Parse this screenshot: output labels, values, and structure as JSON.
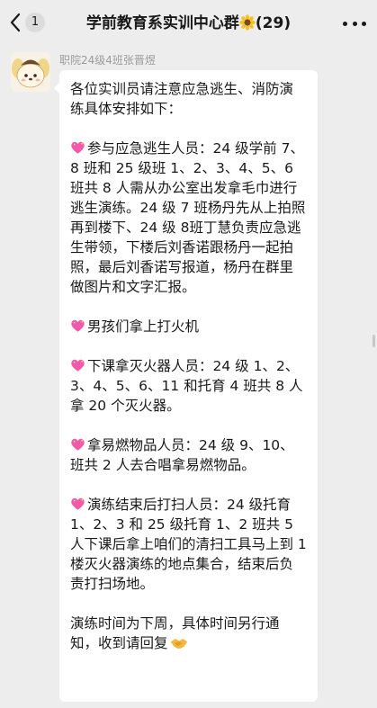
{
  "header": {
    "back_badge": "1",
    "title": "学前教育系实训中心群",
    "title_suffix": "(29)",
    "title_emoji": "sunflower-icon"
  },
  "message": {
    "sender": "职院24级4班张晋煜",
    "intro": "各位实训员请注意应急逃生、消防演练具体安排如下：",
    "sections": [
      {
        "icon": "sparkling-heart-icon",
        "text": "参与应急逃生人员：24 级学前 7、8 班和 25 级班 1、2、3、4、5、6 班共 8 人需从办公室出发拿毛巾进行逃生演练。24 级 7 班杨丹先从上拍照再到楼下、24 级 8班丁慧负责应急逃生带领，下楼后刘香诺跟杨丹一起拍照，最后刘香诺写报道，杨丹在群里做图片和文字汇报。"
      },
      {
        "icon": "sparkling-heart-icon",
        "text": "男孩们拿上打火机"
      },
      {
        "icon": "sparkling-heart-icon",
        "text": "下课拿灭火器人员：24 级 1、2、3、4、5、6、11 和托育 4 班共 8 人拿 20 个灭火器。"
      },
      {
        "icon": "sparkling-heart-icon",
        "text": "拿易燃物品人员：24 级 9、10、班共 2 人去合唱拿易燃物品。"
      },
      {
        "icon": "sparkling-heart-icon",
        "text": "演练结束后打扫人员：24 级托育 1、2、3 和 25 级托育 1、2 班共 5人下课后拿上咱们的清扫工具马上到 1 楼灭火器演练的地点集合，结束后负责打扫场地。"
      }
    ],
    "closing": "演练时间为下周，具体时间另行通知，收到请回复",
    "closing_emoji": "handshake-icon"
  }
}
